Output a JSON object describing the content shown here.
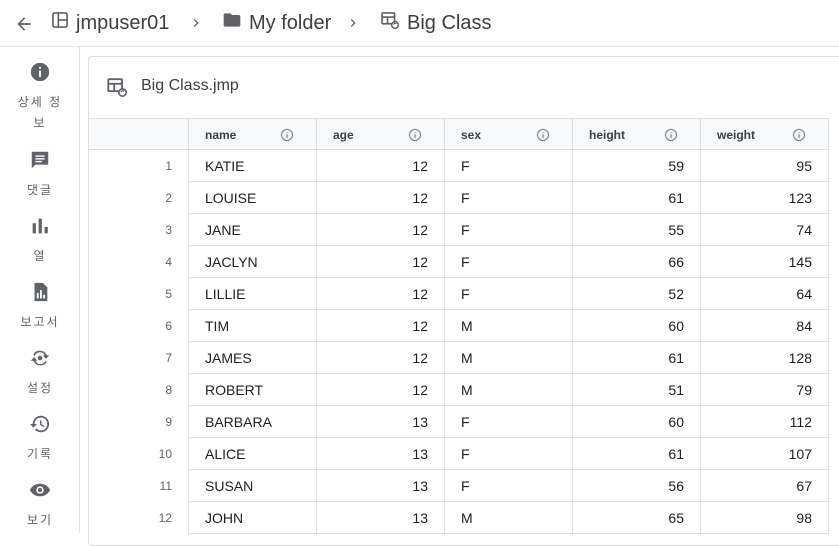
{
  "breadcrumb": {
    "items": [
      {
        "label": "jmpuser01",
        "icon": "workspace-icon"
      },
      {
        "label": "My folder",
        "icon": "folder-icon"
      },
      {
        "label": "Big Class",
        "icon": "data-table-icon"
      }
    ]
  },
  "sidebar": {
    "items": [
      {
        "label": "상세 정보",
        "icon": "info-icon"
      },
      {
        "label": "댓글",
        "icon": "comment-icon"
      },
      {
        "label": "열",
        "icon": "bar-chart-icon"
      },
      {
        "label": "보고서",
        "icon": "report-icon"
      },
      {
        "label": "설정",
        "icon": "settings-sync-icon"
      },
      {
        "label": "기록",
        "icon": "history-icon"
      },
      {
        "label": "보기",
        "icon": "eye-icon"
      }
    ]
  },
  "panel": {
    "file_name": "Big Class.jmp"
  },
  "table": {
    "columns": [
      "name",
      "age",
      "sex",
      "height",
      "weight"
    ],
    "rows": [
      {
        "index": "1",
        "name": "KATIE",
        "age": "12",
        "sex": "F",
        "height": "59",
        "weight": "95"
      },
      {
        "index": "2",
        "name": "LOUISE",
        "age": "12",
        "sex": "F",
        "height": "61",
        "weight": "123"
      },
      {
        "index": "3",
        "name": "JANE",
        "age": "12",
        "sex": "F",
        "height": "55",
        "weight": "74"
      },
      {
        "index": "4",
        "name": "JACLYN",
        "age": "12",
        "sex": "F",
        "height": "66",
        "weight": "145"
      },
      {
        "index": "5",
        "name": "LILLIE",
        "age": "12",
        "sex": "F",
        "height": "52",
        "weight": "64"
      },
      {
        "index": "6",
        "name": "TIM",
        "age": "12",
        "sex": "M",
        "height": "60",
        "weight": "84"
      },
      {
        "index": "7",
        "name": "JAMES",
        "age": "12",
        "sex": "M",
        "height": "61",
        "weight": "128"
      },
      {
        "index": "8",
        "name": "ROBERT",
        "age": "12",
        "sex": "M",
        "height": "51",
        "weight": "79"
      },
      {
        "index": "9",
        "name": "BARBARA",
        "age": "13",
        "sex": "F",
        "height": "60",
        "weight": "112"
      },
      {
        "index": "10",
        "name": "ALICE",
        "age": "13",
        "sex": "F",
        "height": "61",
        "weight": "107"
      },
      {
        "index": "11",
        "name": "SUSAN",
        "age": "13",
        "sex": "F",
        "height": "56",
        "weight": "67"
      },
      {
        "index": "12",
        "name": "JOHN",
        "age": "13",
        "sex": "M",
        "height": "65",
        "weight": "98"
      }
    ]
  }
}
